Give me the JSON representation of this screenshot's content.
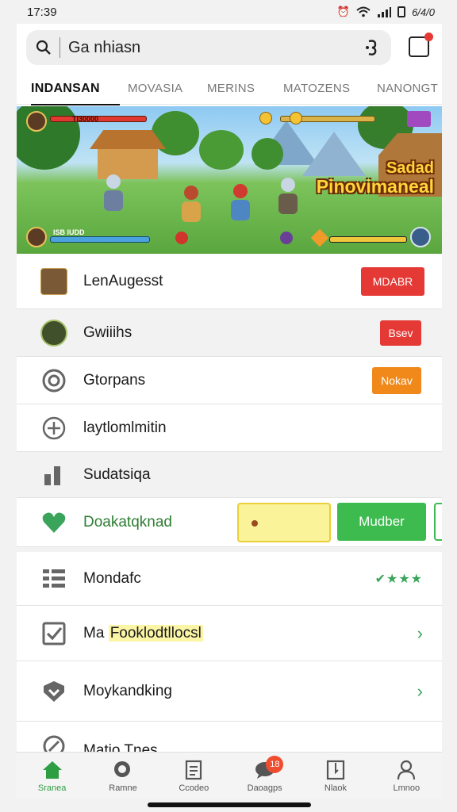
{
  "status": {
    "time": "17:39",
    "indicators": "6/4/0"
  },
  "search": {
    "query": "Ga nhiasn"
  },
  "tabs": [
    {
      "label": "INDANSAN",
      "active": true
    },
    {
      "label": "MOVASIA",
      "active": false
    },
    {
      "label": "MERINS",
      "active": false
    },
    {
      "label": "MATOZENS",
      "active": false
    },
    {
      "label": "NANONGT",
      "active": false
    }
  ],
  "banner": {
    "title_line1": "Sadad",
    "title_line2": "Pinovimaneal",
    "hud_label_top": "TI30000",
    "hud_label_bottom": "ISB  IUDD"
  },
  "list": [
    {
      "label": "LenAugesst",
      "icon": "game-thumbnail-icon",
      "badge": "MDABR",
      "badge_color": "#e53935"
    },
    {
      "label": "Gwiiihs",
      "icon": "game-avatar-icon",
      "badge": "Bsev",
      "badge_color": "#e53935"
    },
    {
      "label": "Gtorpans",
      "icon": "target-icon",
      "badge": "Nokav",
      "badge_color": "#f0891a"
    },
    {
      "label": "laytlomlmitin",
      "icon": "plus-circle-icon"
    },
    {
      "label": "Sudatsiqa",
      "icon": "bar-chart-icon"
    },
    {
      "label": "Doakatqknad",
      "icon": "heart-icon",
      "label_color": "#2e9e43",
      "action_label": "Mudber",
      "action_color": "#3dbb4f",
      "yellow_field": "#fbf39a"
    },
    {
      "label": "Mondafc",
      "icon": "grid-list-icon",
      "stars": "✔★★★"
    },
    {
      "label_prefix": "Ma",
      "label_highlight": "Fooklodtllocsl",
      "icon": "checkbox-icon"
    },
    {
      "label": "Moykandking",
      "icon": "shield-icon"
    },
    {
      "label": "Matio Tnes",
      "icon": "pen-icon"
    }
  ],
  "nav": [
    {
      "label": "Sranea",
      "icon": "home-icon",
      "active": true
    },
    {
      "label": "Ramne",
      "icon": "search-icon",
      "active": false
    },
    {
      "label": "Ccodeo",
      "icon": "document-icon",
      "active": false
    },
    {
      "label": "Daoagps",
      "icon": "chat-icon",
      "active": false,
      "badge": "18"
    },
    {
      "label": "Nlaok",
      "icon": "bookmark-icon",
      "active": false
    },
    {
      "label": "Lmnoo",
      "icon": "profile-icon",
      "active": false
    }
  ]
}
